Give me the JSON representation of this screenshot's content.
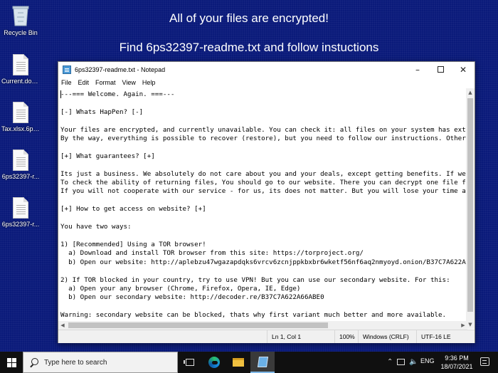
{
  "wallpaper": {
    "line1": "All of your files are encrypted!",
    "line2": "Find 6ps32397-readme.txt and follow instuctions"
  },
  "desktop_icons": [
    {
      "label": "Recycle Bin",
      "icon": "recycle-bin-icon"
    },
    {
      "label": "Current.doc...",
      "icon": "document-icon"
    },
    {
      "label": "Tax.xlsx.6ps...",
      "icon": "document-icon"
    },
    {
      "label": "6ps32397-r...",
      "icon": "document-icon"
    },
    {
      "label": "6ps32397-r...",
      "icon": "document-icon"
    }
  ],
  "notepad": {
    "title": "6ps32397-readme.txt - Notepad",
    "menu": [
      "File",
      "Edit",
      "Format",
      "View",
      "Help"
    ],
    "content": "---=== Welcome. Again. ===---\n\n[-] Whats HapPen? [-]\n\nYour files are encrypted, and currently unavailable. You can check it: all files on your system has exten\nBy the way, everything is possible to recover (restore), but you need to follow our instructions. Otherwi\n\n[+] What guarantees? [+]\n\nIts just a business. We absolutely do not care about you and your deals, except getting benefits. If we d\nTo check the ability of returning files, You should go to our website. There you can decrypt one file for\nIf you will not cooperate with our service - for us, its does not matter. But you will lose your time and\n\n[+] How to get access on website? [+]\n\nYou have two ways:\n\n1) [Recommended] Using a TOR browser!\n  a) Download and install TOR browser from this site: https://torproject.org/\n  b) Open our website: http://aplebzu47wgazapdqks6vrcv6zcnjppkbxbr6wketf56nf6aq2nmyoyd.onion/B37C7A622A66\n\n2) If TOR blocked in your country, try to use VPN! But you can use our secondary website. For this:\n  a) Open your any browser (Chrome, Firefox, Opera, IE, Edge)\n  b) Open our secondary website: http://decoder.re/B37C7A622A66ABE0\n\nWarning: secondary website can be blocked, thats why first variant much better and more available.",
    "status": {
      "position": "Ln 1, Col 1",
      "zoom": "100%",
      "line_ending": "Windows (CRLF)",
      "encoding": "UTF-16 LE"
    }
  },
  "taskbar": {
    "search_placeholder": "Type here to search",
    "language": "ENG",
    "time": "9:36 PM",
    "date": "18/07/2021"
  },
  "colors": {
    "wallpaper": "#0a1a7a",
    "taskbar": "#101010"
  }
}
